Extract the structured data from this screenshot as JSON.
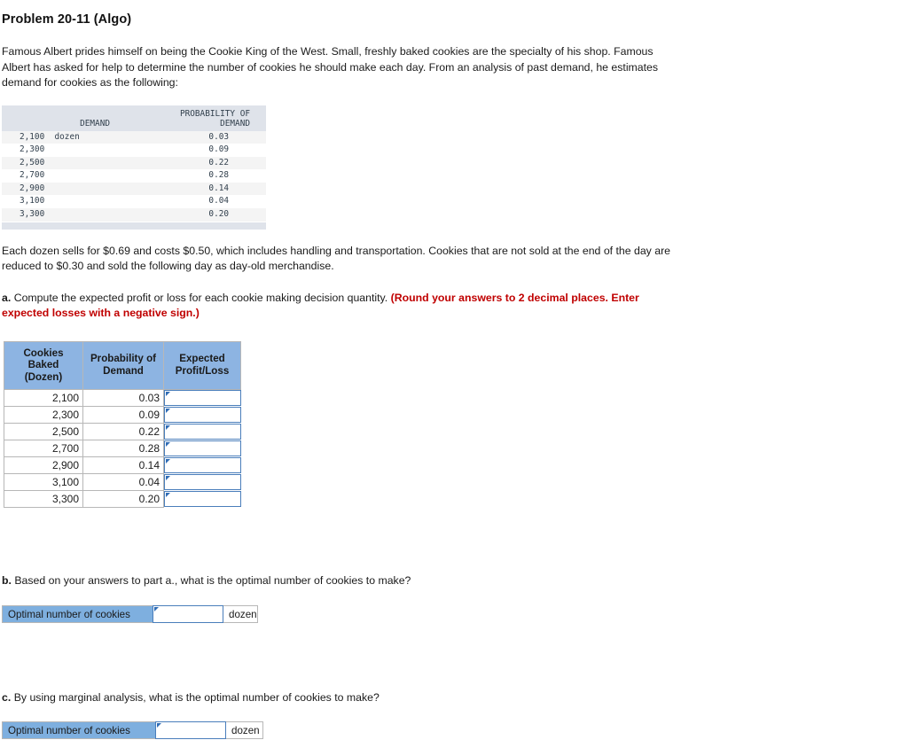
{
  "title": "Problem 20-11 (Algo)",
  "intro": "Famous Albert prides himself on being the Cookie King of the West. Small, freshly baked cookies are the specialty of his shop. Famous Albert has asked for help to determine the number of cookies he should make each day. From an analysis of past demand, he estimates demand for cookies as the following:",
  "exhibit": {
    "headers": [
      "DEMAND",
      "PROBABILITY OF\nDEMAND"
    ],
    "header_col1": "DEMAND",
    "header_col2_line1": "PROBABILITY OF",
    "header_col2_line2": "DEMAND",
    "rows": [
      {
        "demand": "2,100  dozen",
        "probability": "0.03"
      },
      {
        "demand": "2,300",
        "probability": "0.09"
      },
      {
        "demand": "2,500",
        "probability": "0.22"
      },
      {
        "demand": "2,700",
        "probability": "0.28"
      },
      {
        "demand": "2,900",
        "probability": "0.14"
      },
      {
        "demand": "3,100",
        "probability": "0.04"
      },
      {
        "demand": "3,300",
        "probability": "0.20"
      }
    ]
  },
  "cost_paragraph": "Each dozen sells for $0.69 and costs $0.50, which includes handling and transportation. Cookies that are not sold at the end of the day are reduced to $0.30 and sold the following day as day-old merchandise.",
  "part_a": {
    "label": "a.",
    "text": "Compute the expected profit or loss for each cookie making decision quantity.",
    "instruction": "(Round your answers to 2 decimal places. Enter expected losses with a negative sign.)",
    "table": {
      "headers": {
        "col1_line1": "Cookies",
        "col1_line2": "Baked",
        "col1_line3": "(Dozen)",
        "col2_line1": "Probability of",
        "col2_line2": "Demand",
        "col3_line1": "Expected",
        "col3_line2": "Profit/Loss"
      },
      "rows": [
        {
          "cookies_baked": "2,100",
          "probability": "0.03",
          "expected": ""
        },
        {
          "cookies_baked": "2,300",
          "probability": "0.09",
          "expected": ""
        },
        {
          "cookies_baked": "2,500",
          "probability": "0.22",
          "expected": ""
        },
        {
          "cookies_baked": "2,700",
          "probability": "0.28",
          "expected": ""
        },
        {
          "cookies_baked": "2,900",
          "probability": "0.14",
          "expected": ""
        },
        {
          "cookies_baked": "3,100",
          "probability": "0.04",
          "expected": ""
        },
        {
          "cookies_baked": "3,300",
          "probability": "0.20",
          "expected": ""
        }
      ]
    }
  },
  "part_b": {
    "label": "b.",
    "text": "Based on your answers to part a., what is the optimal number of cookies to make?",
    "row_label": "Optimal number of cookies",
    "value": "",
    "unit": "dozen"
  },
  "part_c": {
    "label": "c.",
    "text": "By using marginal analysis, what is the optimal number of cookies to make?",
    "row_label": "Optimal number of cookies",
    "value": "",
    "unit": "dozen"
  },
  "colors": {
    "header_blue": "#8db4e2",
    "strip_blue": "#7eafdf",
    "exhibit_header_gray": "#dfe3ea",
    "input_border_blue": "#4a7ebb",
    "red_instruction": "#c00000"
  }
}
